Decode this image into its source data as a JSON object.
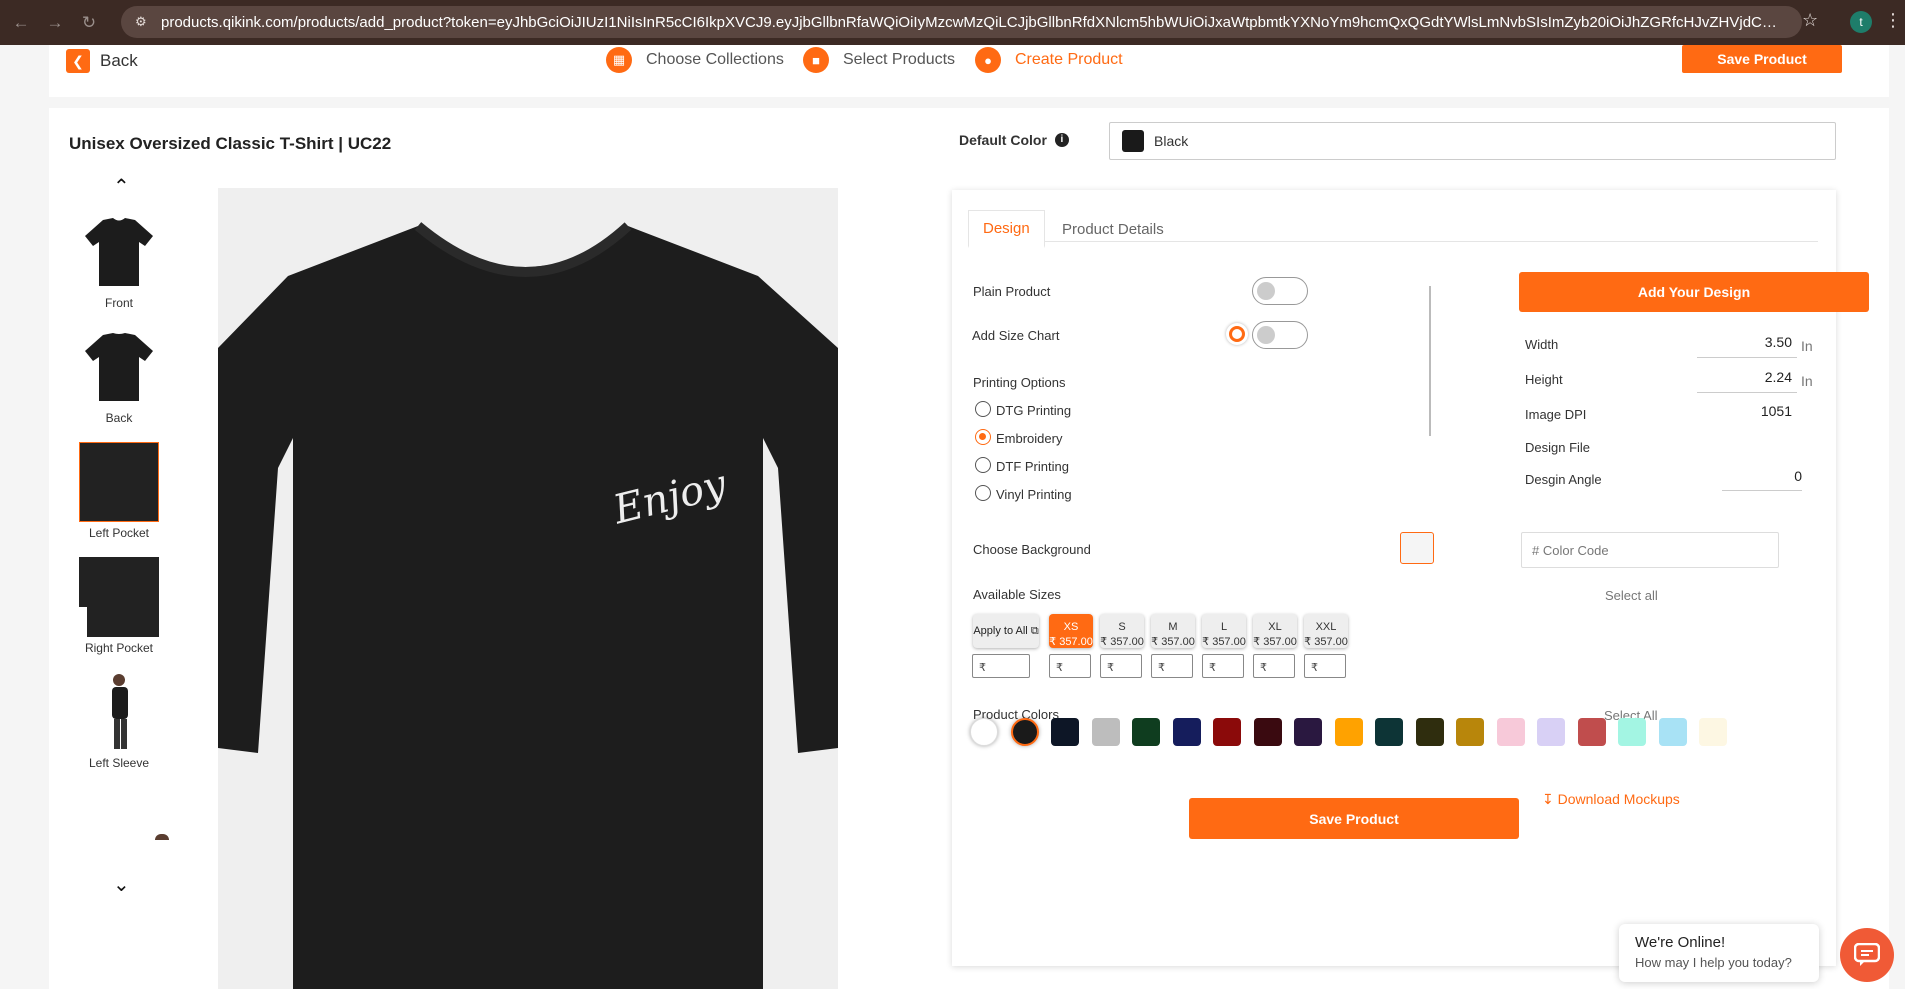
{
  "browser": {
    "url": "products.qikink.com/products/add_product?token=eyJhbGciOiJIUzI1NiIsInR5cCI6IkpXVCJ9.eyJjbGllbnRfaWQiOiIyMzcwMzQiLCJjbGllbnRfdXNlcm5hbWUiOiJxaWtpbmtkYXNoYm9hcmQxQGdtYWlsLmNvbSIsImZyb20iOiJhZGRfcHJvZHVjdCIsInN0b3JlX3R5cGUiOiJzaG9...",
    "profile_initial": "t"
  },
  "topbar": {
    "back_label": "Back",
    "steps": [
      {
        "label": "Choose Collections"
      },
      {
        "label": "Select Products"
      },
      {
        "label": "Create Product"
      }
    ],
    "save_label": "Save Product"
  },
  "product": {
    "title": "Unisex Oversized Classic T-Shirt | UC22",
    "default_color_label": "Default Color",
    "default_color_value": "Black"
  },
  "thumbs": [
    {
      "label": "Front"
    },
    {
      "label": "Back"
    },
    {
      "label": "Left Pocket"
    },
    {
      "label": "Right Pocket"
    },
    {
      "label": "Left Sleeve"
    }
  ],
  "design_text": "Enjoy",
  "tabs": [
    {
      "label": "Design"
    },
    {
      "label": "Product Details"
    }
  ],
  "design": {
    "plain_product": "Plain Product",
    "add_size_chart": "Add Size Chart",
    "printing_options": "Printing Options",
    "options": [
      {
        "label": "DTG Printing",
        "selected": false
      },
      {
        "label": "Embroidery",
        "selected": true
      },
      {
        "label": "DTF Printing",
        "selected": false
      },
      {
        "label": "Vinyl Printing",
        "selected": false
      }
    ],
    "add_design_label": "Add Your Design",
    "width_label": "Width",
    "width_value": "3.50",
    "height_label": "Height",
    "height_value": "2.24",
    "unit": "In",
    "dpi_label": "Image DPI",
    "dpi_value": "1051",
    "design_file_label": "Design File",
    "angle_label": "Desgin Angle",
    "angle_value": "0",
    "choose_background": "Choose Background",
    "color_code_placeholder": "# Color Code",
    "available_sizes": "Available Sizes",
    "select_all_sizes": "Select all",
    "apply_to_all": "Apply to All",
    "sizes": [
      {
        "size": "XS",
        "price": "₹ 357.00",
        "active": true
      },
      {
        "size": "S",
        "price": "₹ 357.00",
        "active": false
      },
      {
        "size": "M",
        "price": "₹ 357.00",
        "active": false
      },
      {
        "size": "L",
        "price": "₹ 357.00",
        "active": false
      },
      {
        "size": "XL",
        "price": "₹ 357.00",
        "active": false
      },
      {
        "size": "XXL",
        "price": "₹ 357.00",
        "active": false
      }
    ],
    "rupee": "₹",
    "product_colors": "Product Colors",
    "select_all_colors": "Select All",
    "colors": [
      "#ffffff",
      "#1a1a1a",
      "#0d1626",
      "#bdbdbd",
      "#0f3d1f",
      "#151d5c",
      "#8b0a0a",
      "#3a0a10",
      "#2a1840",
      "#ffa200",
      "#0d3436",
      "#2f2d0e",
      "#b8860b",
      "#f7c9d9",
      "#d8d0f5",
      "#c04d4d",
      "#a3f5e3",
      "#a8e2f5",
      "#fdf7e3"
    ],
    "save_label": "Save Product",
    "download_label": "Download Mockups"
  },
  "chat": {
    "title": "We're Online!",
    "subtitle": "How may I help you today?"
  }
}
